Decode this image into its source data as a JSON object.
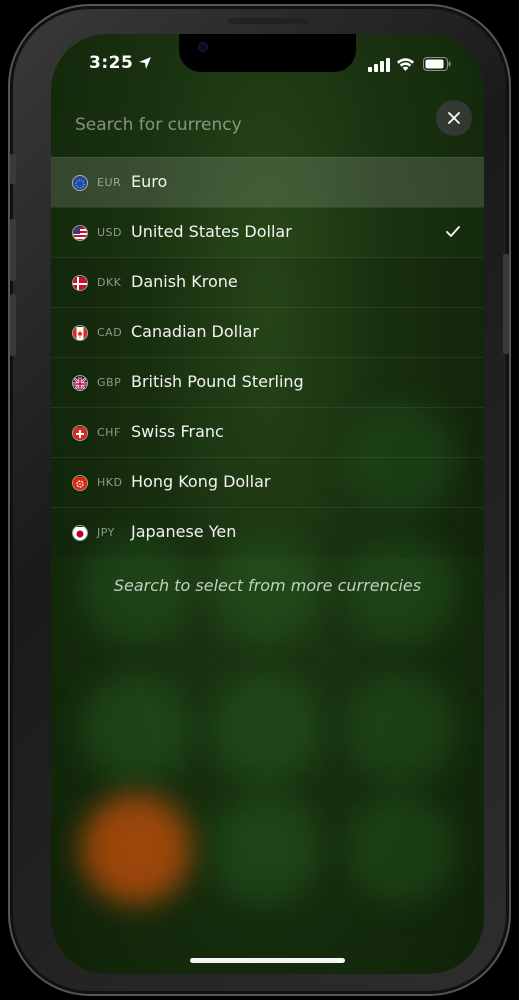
{
  "status_bar": {
    "time": "3:25"
  },
  "search": {
    "placeholder": "Search for currency"
  },
  "currencies": [
    {
      "code": "EUR",
      "name": "Euro",
      "flag": "eu-flag-icon"
    },
    {
      "code": "USD",
      "name": "United States Dollar",
      "flag": "us-flag-icon",
      "checked": true
    },
    {
      "code": "DKK",
      "name": "Danish Krone",
      "flag": "dk-flag-icon"
    },
    {
      "code": "CAD",
      "name": "Canadian Dollar",
      "flag": "ca-flag-icon"
    },
    {
      "code": "GBP",
      "name": "British Pound Sterling",
      "flag": "gb-flag-icon"
    },
    {
      "code": "CHF",
      "name": "Swiss Franc",
      "flag": "ch-flag-icon"
    },
    {
      "code": "HKD",
      "name": "Hong Kong Dollar",
      "flag": "hk-flag-icon"
    },
    {
      "code": "JPY",
      "name": "Japanese Yen",
      "flag": "jp-flag-icon"
    }
  ],
  "hint": "Search to select from more currencies",
  "colors": {
    "background": "#1a3311",
    "accent": "#ffffff"
  }
}
